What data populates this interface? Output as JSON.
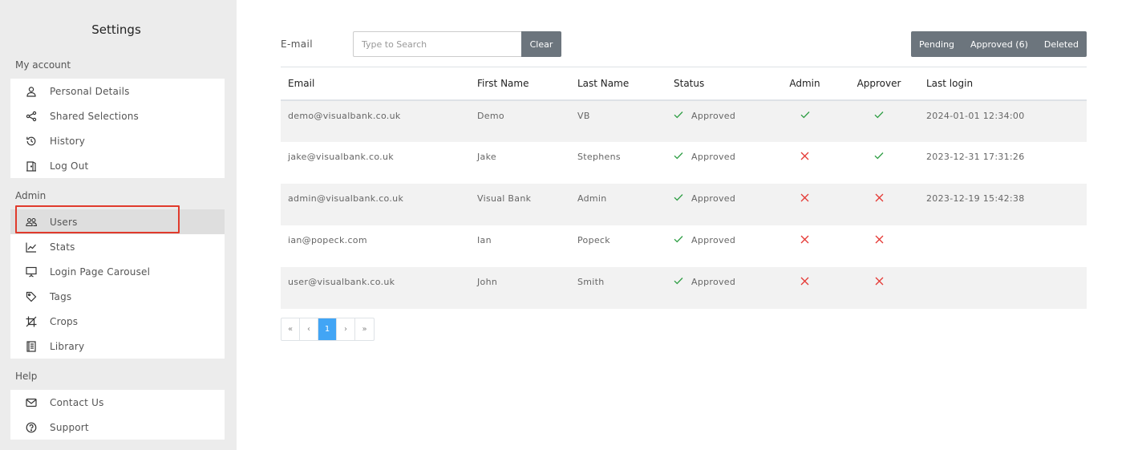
{
  "sidebar": {
    "title": "Settings",
    "sections": {
      "my_account": {
        "label": "My account",
        "items": [
          {
            "label": "Personal Details",
            "icon": "user-icon"
          },
          {
            "label": "Shared Selections",
            "icon": "share-icon"
          },
          {
            "label": "History",
            "icon": "history-icon"
          },
          {
            "label": "Log Out",
            "icon": "logout-icon"
          }
        ]
      },
      "admin": {
        "label": "Admin",
        "items": [
          {
            "label": "Users",
            "icon": "users-icon",
            "active": true
          },
          {
            "label": "Stats",
            "icon": "chart-icon"
          },
          {
            "label": "Login Page Carousel",
            "icon": "presentation-icon"
          },
          {
            "label": "Tags",
            "icon": "tag-icon"
          },
          {
            "label": "Crops",
            "icon": "crop-icon"
          },
          {
            "label": "Library",
            "icon": "library-icon"
          }
        ]
      },
      "help": {
        "label": "Help",
        "items": [
          {
            "label": "Contact Us",
            "icon": "mail-icon"
          },
          {
            "label": "Support",
            "icon": "help-icon"
          }
        ]
      }
    }
  },
  "filter": {
    "label": "E-mail",
    "placeholder": "Type to Search",
    "clear_label": "Clear"
  },
  "status_buttons": {
    "pending": "Pending",
    "approved": "Approved (6)",
    "deleted": "Deleted"
  },
  "table": {
    "headers": {
      "email": "Email",
      "first_name": "First Name",
      "last_name": "Last Name",
      "status": "Status",
      "admin": "Admin",
      "approver": "Approver",
      "last_login": "Last login"
    },
    "rows": [
      {
        "email": "demo@visualbank.co.uk",
        "first_name": "Demo",
        "last_name": "VB",
        "status": "Approved",
        "admin": true,
        "approver": true,
        "last_login": "2024-01-01 12:34:00"
      },
      {
        "email": "jake@visualbank.co.uk",
        "first_name": "Jake",
        "last_name": "Stephens",
        "status": "Approved",
        "admin": false,
        "approver": true,
        "last_login": "2023-12-31 17:31:26"
      },
      {
        "email": "admin@visualbank.co.uk",
        "first_name": "Visual Bank",
        "last_name": "Admin",
        "status": "Approved",
        "admin": false,
        "approver": false,
        "last_login": "2023-12-19 15:42:38"
      },
      {
        "email": "ian@popeck.com",
        "first_name": "Ian",
        "last_name": "Popeck",
        "status": "Approved",
        "admin": false,
        "approver": false,
        "last_login": ""
      },
      {
        "email": "user@visualbank.co.uk",
        "first_name": "John",
        "last_name": "Smith",
        "status": "Approved",
        "admin": false,
        "approver": false,
        "last_login": ""
      }
    ]
  },
  "pagination": {
    "first": "«",
    "prev": "‹",
    "current": "1",
    "next": "›",
    "last": "»"
  },
  "colors": {
    "check": "#2e9e44",
    "cross": "#e53935",
    "accent": "#42a5f5",
    "button": "#6c757d"
  }
}
